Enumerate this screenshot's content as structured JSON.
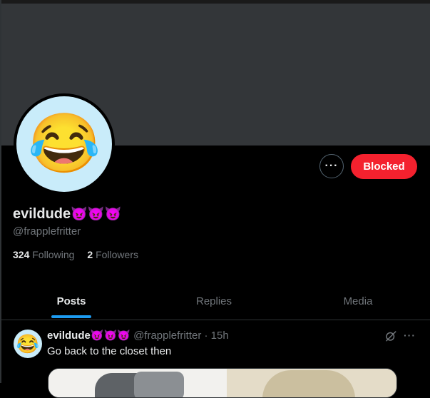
{
  "profile": {
    "display_name": "evildude",
    "name_emojis": "😈😈😈",
    "handle": "@frapplefritter",
    "avatar_emoji": "😂",
    "following_count": "324",
    "following_label": "Following",
    "followers_count": "2",
    "followers_label": "Followers"
  },
  "actions": {
    "more_icon": "more-horizontal-icon",
    "more_glyph": "···",
    "blocked_label": "Blocked"
  },
  "tabs": [
    {
      "label": "Posts",
      "active": true
    },
    {
      "label": "Replies",
      "active": false
    },
    {
      "label": "Media",
      "active": false
    }
  ],
  "tweet": {
    "name": "evildude",
    "name_emojis": "😈😈😈",
    "handle": "@frapplefritter",
    "separator": "·",
    "time": "15h",
    "text": "Go back to the closet then",
    "avatar_emoji": "😂",
    "more_glyph": "···"
  },
  "colors": {
    "background": "#000000",
    "banner": "#333639",
    "blocked": "#f4212e",
    "accent": "#1d9bf0",
    "secondary_text": "#71767b"
  }
}
